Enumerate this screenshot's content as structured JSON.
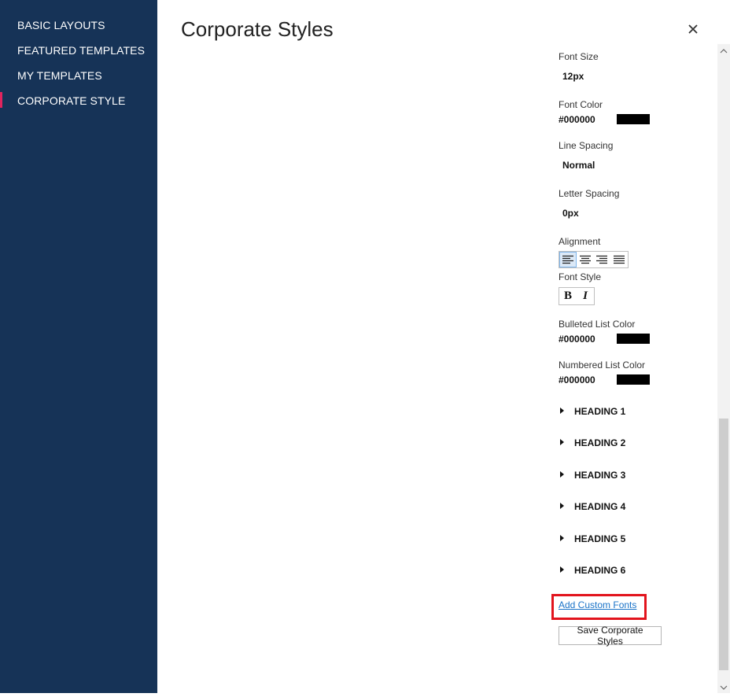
{
  "sidebar": {
    "items": [
      {
        "label": "BASIC LAYOUTS"
      },
      {
        "label": "FEATURED TEMPLATES"
      },
      {
        "label": "MY TEMPLATES"
      },
      {
        "label": "CORPORATE STYLE",
        "active": true
      }
    ]
  },
  "header": {
    "title": "Corporate Styles",
    "close_label": "×"
  },
  "styles": {
    "font_size": {
      "label": "Font Size",
      "value": "12px"
    },
    "font_color": {
      "label": "Font Color",
      "value": "#000000",
      "swatch": "#000000"
    },
    "line_spacing": {
      "label": "Line Spacing",
      "value": "Normal"
    },
    "letter_spacing": {
      "label": "Letter Spacing",
      "value": "0px"
    },
    "alignment": {
      "label": "Alignment",
      "options": [
        "left",
        "center",
        "right",
        "justify"
      ],
      "selected": "left"
    },
    "font_style": {
      "label": "Font Style",
      "bold": "B",
      "italic": "I"
    },
    "bulleted_list_color": {
      "label": "Bulleted List Color",
      "value": "#000000",
      "swatch": "#000000"
    },
    "numbered_list_color": {
      "label": "Numbered List Color",
      "value": "#000000",
      "swatch": "#000000"
    }
  },
  "headings": [
    {
      "label": "HEADING 1"
    },
    {
      "label": "HEADING 2"
    },
    {
      "label": "HEADING 3"
    },
    {
      "label": "HEADING 4"
    },
    {
      "label": "HEADING 5"
    },
    {
      "label": "HEADING 6"
    }
  ],
  "actions": {
    "add_custom_fonts": "Add Custom Fonts",
    "save": "Save Corporate Styles"
  },
  "colors": {
    "sidebar_bg": "#163357",
    "active_marker": "#e0245e",
    "link": "#1a73c8",
    "highlight_box": "#e2141d"
  }
}
